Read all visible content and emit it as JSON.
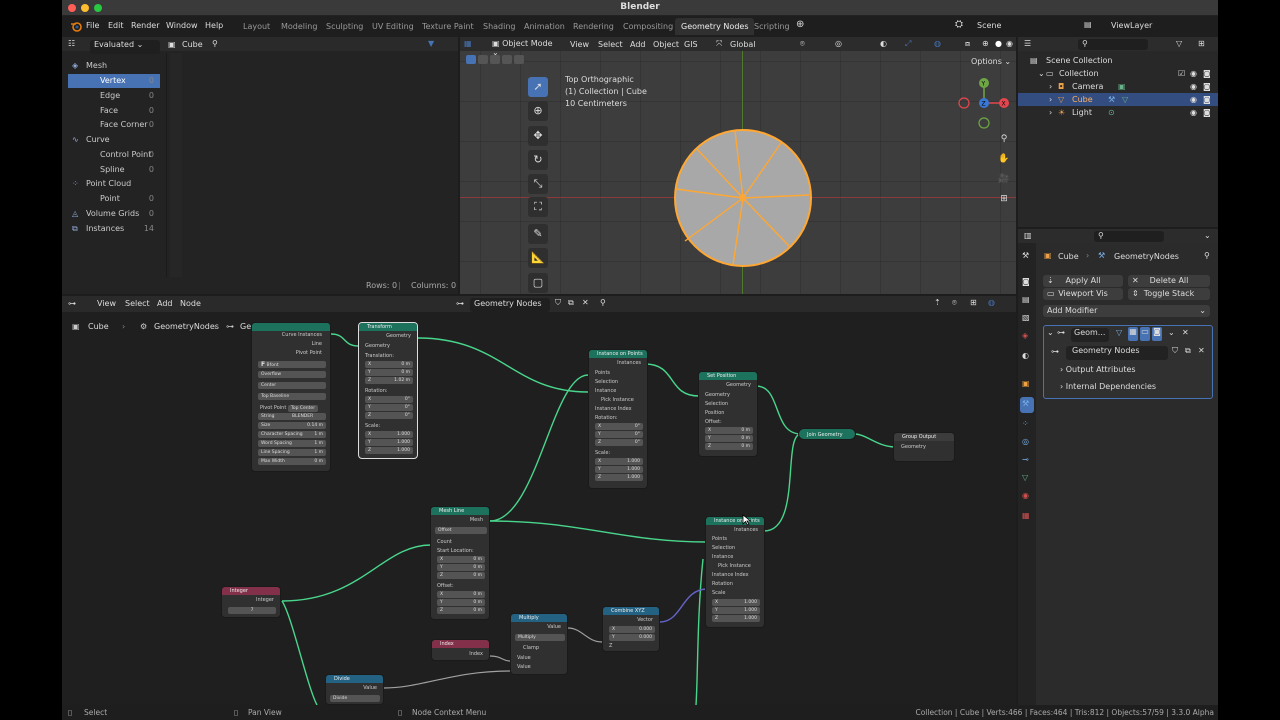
{
  "window": {
    "title": "Blender"
  },
  "menu": {
    "file": "File",
    "edit": "Edit",
    "render": "Render",
    "window": "Window",
    "help": "Help"
  },
  "workspace_tabs": [
    "Layout",
    "Modeling",
    "Sculpting",
    "UV Editing",
    "Texture Paint",
    "Shading",
    "Animation",
    "Rendering",
    "Compositing",
    "Geometry Nodes",
    "Scripting"
  ],
  "active_workspace": "Geometry Nodes",
  "scene": {
    "label": "Scene",
    "viewlayer": "ViewLayer"
  },
  "spreadsheet": {
    "mode": "Evaluated",
    "object": "Cube",
    "rows": [
      {
        "label": "Mesh",
        "count": ""
      },
      {
        "label": "Vertex",
        "count": "0"
      },
      {
        "label": "Edge",
        "count": "0"
      },
      {
        "label": "Face",
        "count": "0"
      },
      {
        "label": "Face Corner",
        "count": "0"
      },
      {
        "label": "Curve",
        "count": ""
      },
      {
        "label": "Control Point",
        "count": "0"
      },
      {
        "label": "Spline",
        "count": "0"
      },
      {
        "label": "Point Cloud",
        "count": ""
      },
      {
        "label": "Point",
        "count": "0"
      },
      {
        "label": "Volume Grids",
        "count": "0"
      },
      {
        "label": "Instances",
        "count": "14"
      }
    ],
    "rows_label": "Rows: 0",
    "columns_label": "Columns: 0"
  },
  "viewport": {
    "mode": "Object Mode",
    "menus": [
      "View",
      "Select",
      "Add",
      "Object",
      "GIS"
    ],
    "transform": "Global",
    "options": "Options",
    "info_line1": "Top Orthographic",
    "info_line2": "(1) Collection | Cube",
    "info_line3": "10 Centimeters"
  },
  "node_editor": {
    "menus": [
      "View",
      "Select",
      "Add",
      "Node"
    ],
    "tree_name": "Geometry Nodes",
    "breadcrumb": [
      "Cube",
      "GeometryNodes",
      "Geometry Nodes"
    ],
    "nodes": {
      "string_to_curves": {
        "outputs": [
          "Curve Instances",
          "Line",
          "Pivot Point"
        ],
        "font": "Bfont",
        "overflow": "Overflow",
        "align_x": "Center",
        "align_y": "Top Baseline",
        "pivot_label": "Pivot Point",
        "pivot_value": "Top Center",
        "string_label": "String",
        "string_value": "BLENDER",
        "size_label": "Size",
        "size_value": "0.14 m",
        "char_spacing_label": "Character Spacing",
        "char_spacing_value": "1 m",
        "word_spacing_label": "Word Spacing",
        "word_spacing_value": "1 m",
        "line_spacing_label": "Line Spacing",
        "line_spacing_value": "1 m",
        "max_width_label": "Max Width",
        "max_width_value": "0 m"
      },
      "transform": {
        "title": "Transform",
        "out": "Geometry",
        "geometry": "Geometry",
        "translation": "Translation:",
        "tx": "0 m",
        "ty": "0 m",
        "tz": "1.02 m",
        "rotation": "Rotation:",
        "rx": "0°",
        "ry": "0°",
        "rz": "0°",
        "scale": "Scale:",
        "sx": "1.000",
        "sy": "1.000",
        "sz": "1.000"
      },
      "instance_on_points_1": {
        "title": "Instance on Points",
        "out": "Instances",
        "points": "Points",
        "selection": "Selection",
        "instance": "Instance",
        "pick": "Pick Instance",
        "index": "Instance Index",
        "rotation": "Rotation:",
        "rx": "0°",
        "ry": "0°",
        "rz": "0°",
        "scale": "Scale:",
        "sx": "1.000",
        "sy": "1.000",
        "sz": "1.000"
      },
      "set_position": {
        "title": "Set Position",
        "out": "Geometry",
        "geometry": "Geometry",
        "selection": "Selection",
        "position": "Position",
        "offset": "Offset:",
        "ox": "0 m",
        "oy": "0 m",
        "oz": "0 m"
      },
      "join_geometry": {
        "title": "Join Geometry"
      },
      "group_output": {
        "title": "Group Output",
        "geometry": "Geometry"
      },
      "mesh_line": {
        "title": "Mesh Line",
        "out": "Mesh",
        "mode": "Offset",
        "count": "Count",
        "start": "Start Location:",
        "sx": "0 m",
        "sy": "0 m",
        "sz": "0 m",
        "offset": "Offset:",
        "ox": "0 m",
        "oy": "0 m",
        "oz": "0 m"
      },
      "instance_on_points_2": {
        "title": "Instance on Points",
        "out": "Instances",
        "points": "Points",
        "selection": "Selection",
        "instance": "Instance",
        "pick": "Pick Instance",
        "index": "Instance Index",
        "rotation": "Rotation",
        "scale": "Scale",
        "sx": "1.000",
        "sy": "1.000",
        "sz": "1.000"
      },
      "integer": {
        "title": "Integer",
        "out": "Integer",
        "value": "7"
      },
      "combine_xyz": {
        "title": "Combine XYZ",
        "out": "Vector",
        "x": "0.000",
        "y": "0.000",
        "z": "Z"
      },
      "multiply": {
        "title": "Multiply",
        "out": "Value",
        "op": "Multiply",
        "clamp": "Clamp",
        "v1": "Value",
        "v2": "Value"
      },
      "index": {
        "title": "Index",
        "out": "Index"
      },
      "divide": {
        "title": "Divide",
        "out": "Value",
        "op": "Divide"
      }
    }
  },
  "outliner": {
    "rows": [
      {
        "label": "Scene Collection"
      },
      {
        "label": "Collection"
      },
      {
        "label": "Camera"
      },
      {
        "label": "Cube"
      },
      {
        "label": "Light"
      }
    ]
  },
  "properties": {
    "object": "Cube",
    "modifier_name": "GeometryNodes",
    "apply_all": "Apply All",
    "delete_all": "Delete All",
    "viewport_vis": "Viewport Vis",
    "toggle_stack": "Toggle Stack",
    "add_modifier": "Add Modifier",
    "modifier_short": "Geom...",
    "node_group": "Geometry Nodes",
    "output_attributes": "Output Attributes",
    "internal_deps": "Internal Dependencies"
  },
  "status": {
    "select": "Select",
    "pan": "Pan View",
    "context": "Node Context Menu",
    "stats": "Collection | Cube | Verts:466 | Faces:464 | Tris:812 | Objects:57/59 | 3.3.0 Alpha"
  },
  "colors": {
    "accent_blue": "#4772b3",
    "geometry_socket": "#00d6a3",
    "node_geometry_header": "#1d725e",
    "node_input_header": "#83314a",
    "node_converter_header": "#246283",
    "selection_orange": "#ffa733"
  }
}
